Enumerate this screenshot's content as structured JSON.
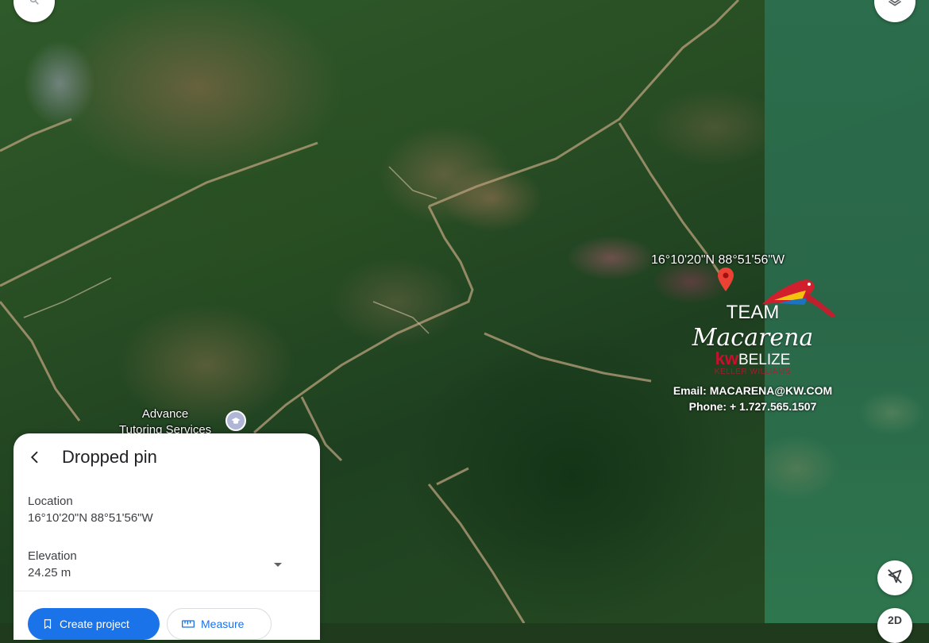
{
  "map": {
    "coordinate_label": "16°10'20\"N 88°51'56\"W",
    "poi": {
      "name_line1": "Advance",
      "name_line2": "Tutoring Services",
      "icon": "school-icon"
    }
  },
  "watermark": {
    "team": "TEAM",
    "team_script": "Macarena",
    "kw": "kw",
    "belize": "BELIZE",
    "keller": "KELLER WILLIAMS",
    "email": "Email: MACARENA@KW.COM",
    "phone": "Phone: + 1.727.565.1507"
  },
  "controls": {
    "search_icon": "search-icon",
    "layers_icon": "layers-icon",
    "compass_icon": "location-off-icon",
    "view_toggle": "2D"
  },
  "panel": {
    "title": "Dropped pin",
    "location_label": "Location",
    "location_value": "16°10'20\"N 88°51'56\"W",
    "elevation_label": "Elevation",
    "elevation_value": "24.25 m",
    "primary_button": "Create project",
    "secondary_button": "Measure"
  },
  "colors": {
    "accent": "#1a73e8",
    "pin": "#ea4335",
    "brand": "#c8102e"
  }
}
